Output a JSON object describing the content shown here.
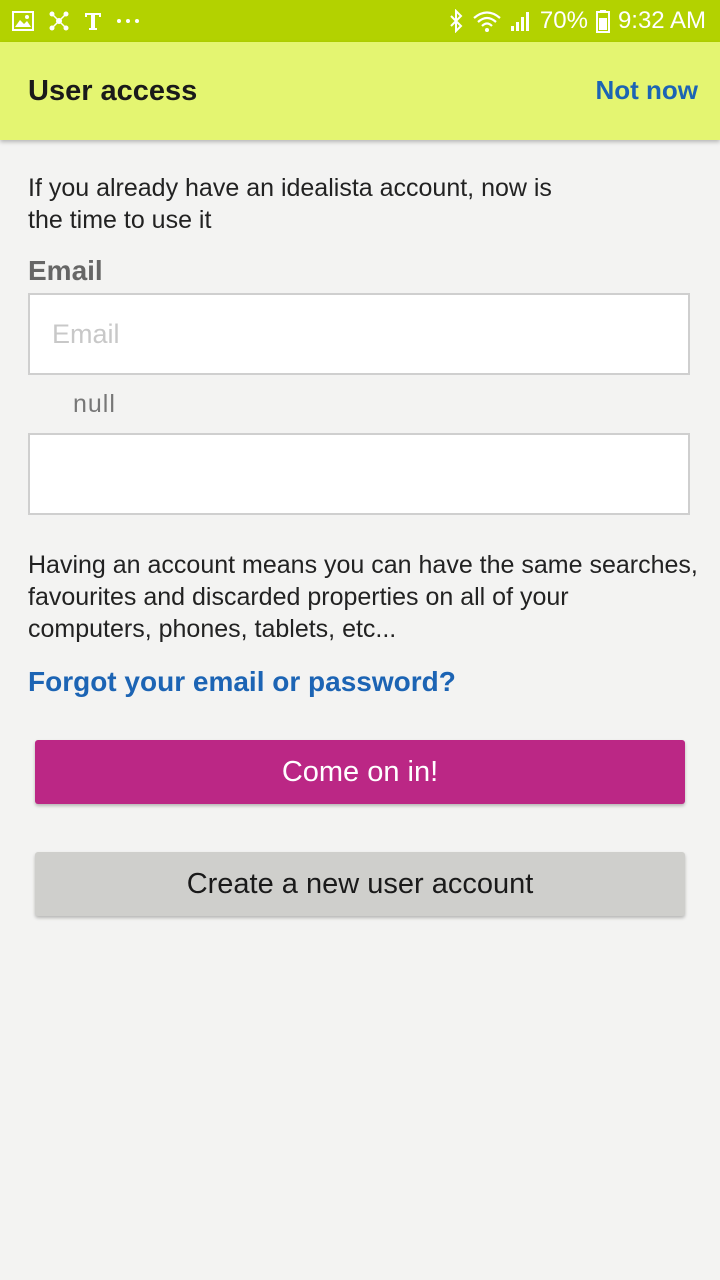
{
  "status_bar": {
    "battery": "70%",
    "time": "9:32 AM",
    "left_icons": [
      "gallery-icon",
      "nodes-icon",
      "t-icon",
      "more-dots-icon"
    ],
    "right_icons": [
      "bluetooth-icon",
      "wifi-icon",
      "signal-icon",
      "battery-icon"
    ]
  },
  "header": {
    "title": "User access",
    "not_now": "Not now"
  },
  "intro_text": "If you already have an idealista account, now is the time to use it",
  "form": {
    "email_label": "Email",
    "email_placeholder": "Email",
    "email_value": "",
    "null_label": "null",
    "password_value": ""
  },
  "info_text": "Having an account means you can have the same searches, favourites and discarded properties on all of your computers, phones, tablets, etc...",
  "forgot_link": "Forgot your email or password?",
  "buttons": {
    "login": "Come on in!",
    "create_account": "Create a new user account"
  },
  "colors": {
    "status_bar": "#b3d200",
    "app_bar": "#e4f571",
    "link": "#1c64b4",
    "primary_button": "#bb2785",
    "secondary_button": "#cfcfcc",
    "background": "#f3f3f2"
  }
}
